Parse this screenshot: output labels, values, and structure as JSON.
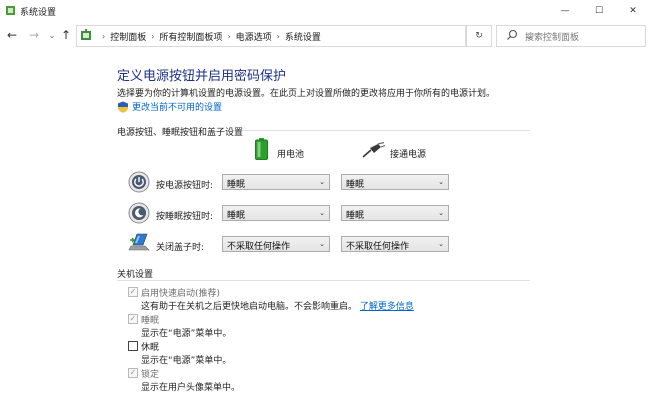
{
  "window": {
    "title": "系统设置",
    "minimize_glyph": "—",
    "maximize_glyph": "☐",
    "close_glyph": "✕"
  },
  "address_bar": {
    "back_glyph": "←",
    "forward_glyph": "→",
    "recent_glyph": "⌄",
    "up_glyph": "↑",
    "breadcrumb_separator": "›",
    "breadcrumbs": [
      "控制面板",
      "所有控制面板项",
      "电源选项",
      "系统设置"
    ],
    "dropdown_glyph": "⌄",
    "refresh_glyph": "↻",
    "search_placeholder": "搜索控制面板"
  },
  "page": {
    "heading": "定义电源按钮并启用密码保护",
    "description": "选择要为你的计算机设置的电源设置。在此页上对设置所做的更改将应用于你所有的电源计划。",
    "change_link": "更改当前不可用的设置"
  },
  "buttons_section": {
    "label": "电源按钮、睡眠按钮和盖子设置",
    "columns": [
      "用电池",
      "接通电源"
    ],
    "rows": [
      {
        "label": "按电源按钮时:",
        "battery": "睡眠",
        "plugged": "睡眠",
        "icon": "power-icon"
      },
      {
        "label": "按睡眠按钮时:",
        "battery": "睡眠",
        "plugged": "睡眠",
        "icon": "sleep-icon"
      },
      {
        "label": "关闭盖子时:",
        "battery": "不采取任何操作",
        "plugged": "不采取任何操作",
        "icon": "laptop-lid-icon"
      }
    ],
    "dropdown_glyph": "⌄"
  },
  "shutdown_section": {
    "label": "关机设置",
    "items": [
      {
        "label": "启用快速启动(推荐)",
        "desc": "这有助于在关机之后更快地启动电脑。不会影响重启。",
        "link": "了解更多信息",
        "checked": true,
        "enabled": false,
        "check_glyph": "✓"
      },
      {
        "label": "睡眠",
        "desc": "显示在“电源”菜单中。",
        "checked": true,
        "enabled": false,
        "check_glyph": "✓"
      },
      {
        "label": "休眠",
        "desc": "显示在“电源”菜单中。",
        "checked": false,
        "enabled": true,
        "check_glyph": ""
      },
      {
        "label": "锁定",
        "desc": "显示在用户头像菜单中。",
        "checked": true,
        "enabled": false,
        "check_glyph": "✓"
      }
    ]
  },
  "colors": {
    "heading": "#1e3287",
    "link": "#0066cc",
    "battery_green": "#2e9e2e"
  }
}
